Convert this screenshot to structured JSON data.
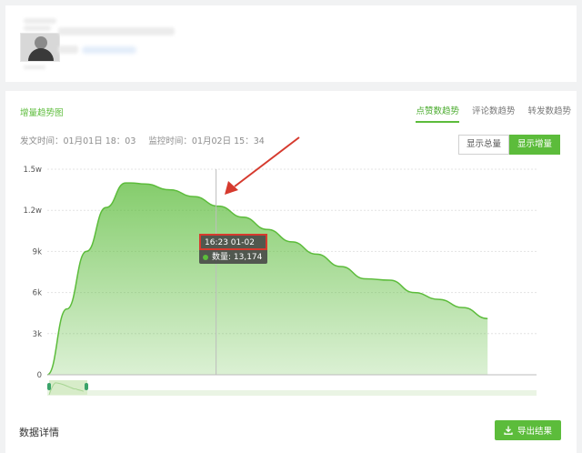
{
  "panel": {
    "title": "增量趋势图",
    "tabs": [
      {
        "label": "点赞数趋势",
        "active": true
      },
      {
        "label": "评论数趋势",
        "active": false
      },
      {
        "label": "转发数趋势",
        "active": false
      }
    ],
    "publish_label": "发文时间：",
    "publish_time": "01月01日 18：03",
    "monitor_label": "监控时间：",
    "monitor_time": "01月02日 15：34",
    "toggle_total": "显示总量",
    "toggle_increment": "显示增量"
  },
  "tooltip": {
    "time": "16:23 01-02",
    "value_label": "数量: 13,174"
  },
  "detail": {
    "title": "数据详情",
    "export_label": "导出结果"
  },
  "colors": {
    "accent": "#5cbc3b",
    "area_fill": "#b9e3aa",
    "annotation_red": "#d63a2e"
  },
  "chart_data": {
    "type": "area",
    "y_ticks": [
      "0",
      "3k",
      "6k",
      "9k",
      "1.2w",
      "1.5w"
    ],
    "ylim": [
      0,
      15000
    ],
    "x_range": [
      0,
      100
    ],
    "x": [
      0,
      4,
      8,
      12,
      16,
      17,
      20,
      25,
      30,
      35,
      40,
      45,
      50,
      55,
      60,
      65,
      70,
      75,
      80,
      85,
      90
    ],
    "values": [
      0,
      4800,
      9000,
      12200,
      14000,
      14000,
      13920,
      13500,
      13000,
      12300,
      11500,
      10600,
      9700,
      8800,
      7900,
      7000,
      6900,
      6000,
      5500,
      4900,
      4100
    ],
    "hover_x": 34.5,
    "hover_value": 13174
  }
}
